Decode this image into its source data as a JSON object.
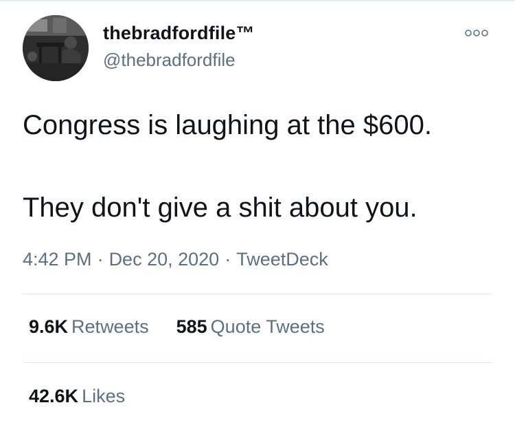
{
  "author": {
    "display_name": "thebradfordfile™",
    "handle": "@thebradfordfile"
  },
  "tweet": {
    "lines": [
      "Congress is laughing at the $600.",
      "They don't give a shit about you."
    ],
    "time": "4:42 PM",
    "date": "Dec 20, 2020",
    "separator": "·",
    "source": "TweetDeck"
  },
  "stats": {
    "retweets_count": "9.6K",
    "retweets_label": "Retweets",
    "quotes_count": "585",
    "quotes_label": "Quote Tweets",
    "likes_count": "42.6K",
    "likes_label": "Likes"
  },
  "icons": {
    "more": "more-dots-icon"
  },
  "colors": {
    "text_primary": "#0f1419",
    "text_secondary": "#5b7083",
    "divider": "#e1e8ed"
  }
}
